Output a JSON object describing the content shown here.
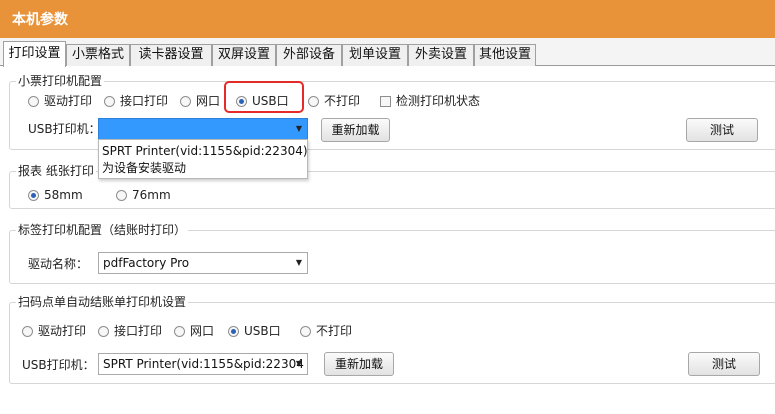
{
  "window": {
    "title": "本机参数"
  },
  "tabs": [
    {
      "label": "打印设置",
      "active": true
    },
    {
      "label": "小票格式"
    },
    {
      "label": "读卡器设置"
    },
    {
      "label": "双屏设置"
    },
    {
      "label": "外部设备"
    },
    {
      "label": "划单设置"
    },
    {
      "label": "外卖设置"
    },
    {
      "label": "其他设置"
    }
  ],
  "receipt_printer": {
    "title": "小票打印机配置",
    "options": [
      "驱动打印",
      "接口打印",
      "网口",
      "USB口",
      "不打印"
    ],
    "selected": "USB口",
    "check_status_label": "检测打印机状态",
    "usb_label": "USB打印机：",
    "usb_value": "",
    "dropdown_items": [
      "SPRT Printer(vid:1155&pid:22304)",
      "为设备安装驱动"
    ],
    "reload_button": "重新加载",
    "test_button": "测试"
  },
  "report_paper": {
    "title": "报表 纸张打印",
    "options": [
      "58mm",
      "76mm"
    ],
    "selected": "58mm"
  },
  "label_printer": {
    "title": "标签打印机配置（结账时打印）",
    "driver_label": "驱动名称：",
    "driver_value": "pdfFactory Pro"
  },
  "scan_printer": {
    "title": "扫码点单自动结账单打印机设置",
    "options": [
      "驱动打印",
      "接口打印",
      "网口",
      "USB口",
      "不打印"
    ],
    "selected": "USB口",
    "usb_label": "USB打印机：",
    "usb_value": "SPRT Printer(vid:1155&pid:22304",
    "reload_button": "重新加载",
    "test_button": "测试"
  },
  "colors": {
    "accent": "#e8923a",
    "selection": "#3399ff",
    "highlight_box": "#e52a2a"
  }
}
